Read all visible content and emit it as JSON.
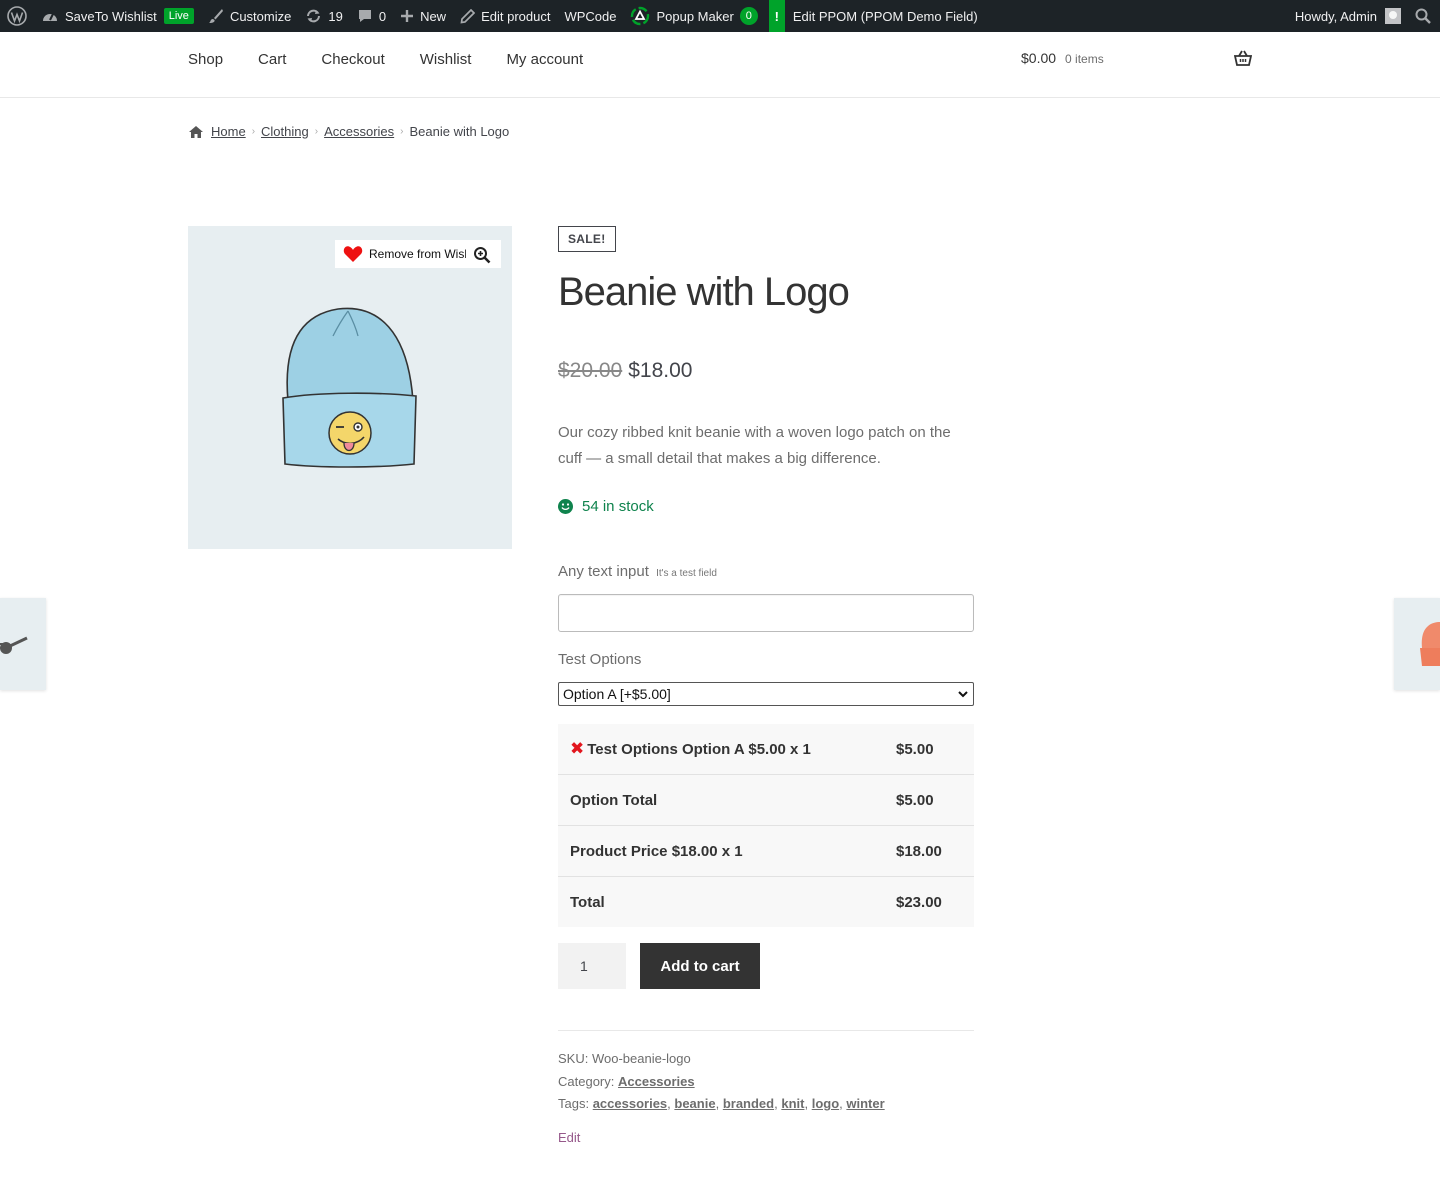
{
  "adminbar": {
    "site_name": "SaveTo Wishlist",
    "live_badge": "Live",
    "customize": "Customize",
    "updates_count": "19",
    "comments_count": "0",
    "new_label": "New",
    "edit_product": "Edit product",
    "wpcode": "WPCode",
    "popup_maker": "Popup Maker",
    "popup_count": "0",
    "ppom_flag": "!",
    "edit_ppom": "Edit PPOM (PPOM Demo Field)",
    "howdy": "Howdy, Admin"
  },
  "nav": {
    "items": [
      "Shop",
      "Cart",
      "Checkout",
      "Wishlist",
      "My account"
    ],
    "cart_total": "$0.00",
    "cart_items": "0 items"
  },
  "breadcrumb": {
    "home": "Home",
    "clothing": "Clothing",
    "accessories": "Accessories",
    "current": "Beanie with Logo"
  },
  "gallery": {
    "wishlist_label": "Remove from Wishlist"
  },
  "product": {
    "sale_badge": "SALE!",
    "title": "Beanie with Logo",
    "old_price": "$20.00",
    "price": "$18.00",
    "description": "Our cozy ribbed knit beanie with a woven logo patch on the cuff — a small detail that makes a big difference.",
    "stock": "54 in stock",
    "text_field_label": "Any text input",
    "text_field_hint": "It's a test field",
    "text_field_value": "",
    "options_label": "Test Options",
    "options_selected": "Option A [+$5.00]",
    "price_table": [
      {
        "label": "Test Options Option A $5.00 x 1",
        "amount": "$5.00"
      },
      {
        "label": "Option Total",
        "amount": "$5.00"
      },
      {
        "label": "Product Price $18.00 x 1",
        "amount": "$18.00"
      },
      {
        "label": "Total",
        "amount": "$23.00"
      }
    ],
    "quantity": "1",
    "add_to_cart": "Add to cart",
    "sku_label": "SKU:",
    "sku": "Woo-beanie-logo",
    "category_label": "Category:",
    "category": "Accessories",
    "tags_label": "Tags:",
    "tags": [
      "accessories",
      "beanie",
      "branded",
      "knit",
      "logo",
      "winter"
    ],
    "edit": "Edit"
  },
  "colors": {
    "adminbar_bg": "#1d2327",
    "accent_green": "#00a32a",
    "stock_green": "#0f834d",
    "button_dark": "#333333",
    "remove_red": "#e2161e",
    "edit_purple": "#96588a"
  },
  "icons": [
    "wordpress-icon",
    "dashboard-icon",
    "brush-icon",
    "refresh-icon",
    "comment-icon",
    "plus-icon",
    "pencil-icon",
    "popup-maker-icon",
    "search-icon",
    "basket-icon",
    "home-icon",
    "heart-icon",
    "zoom-icon",
    "smile-icon",
    "close-icon",
    "chevron-down-icon"
  ]
}
